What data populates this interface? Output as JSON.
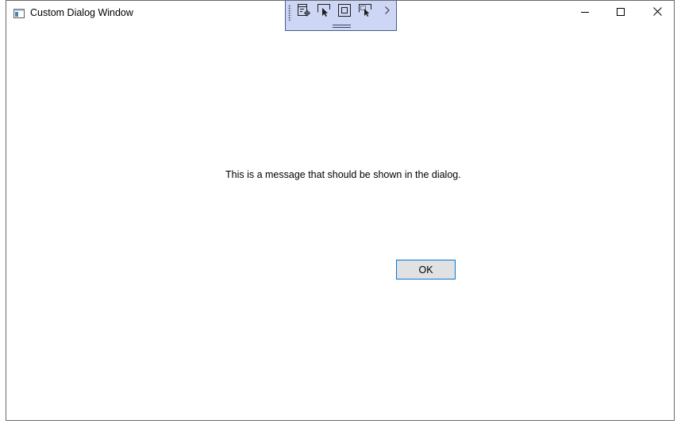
{
  "window": {
    "title": "Custom Dialog Window"
  },
  "caption_buttons": {
    "minimize_icon": "minimize-icon",
    "maximize_icon": "maximize-icon",
    "close_icon": "close-icon"
  },
  "dev_toolbar": {
    "background": "#cdd6f5",
    "icons": [
      "live-visual-tree-icon",
      "select-element-icon",
      "display-layout-adorners-icon",
      "track-focused-element-icon",
      "chevron-right-icon"
    ]
  },
  "dialog": {
    "message": "This is a message that should be shown in the dialog.",
    "ok_label": "OK"
  },
  "colors": {
    "button_focus_border": "#0078d7",
    "button_background": "#e1e1e1"
  }
}
